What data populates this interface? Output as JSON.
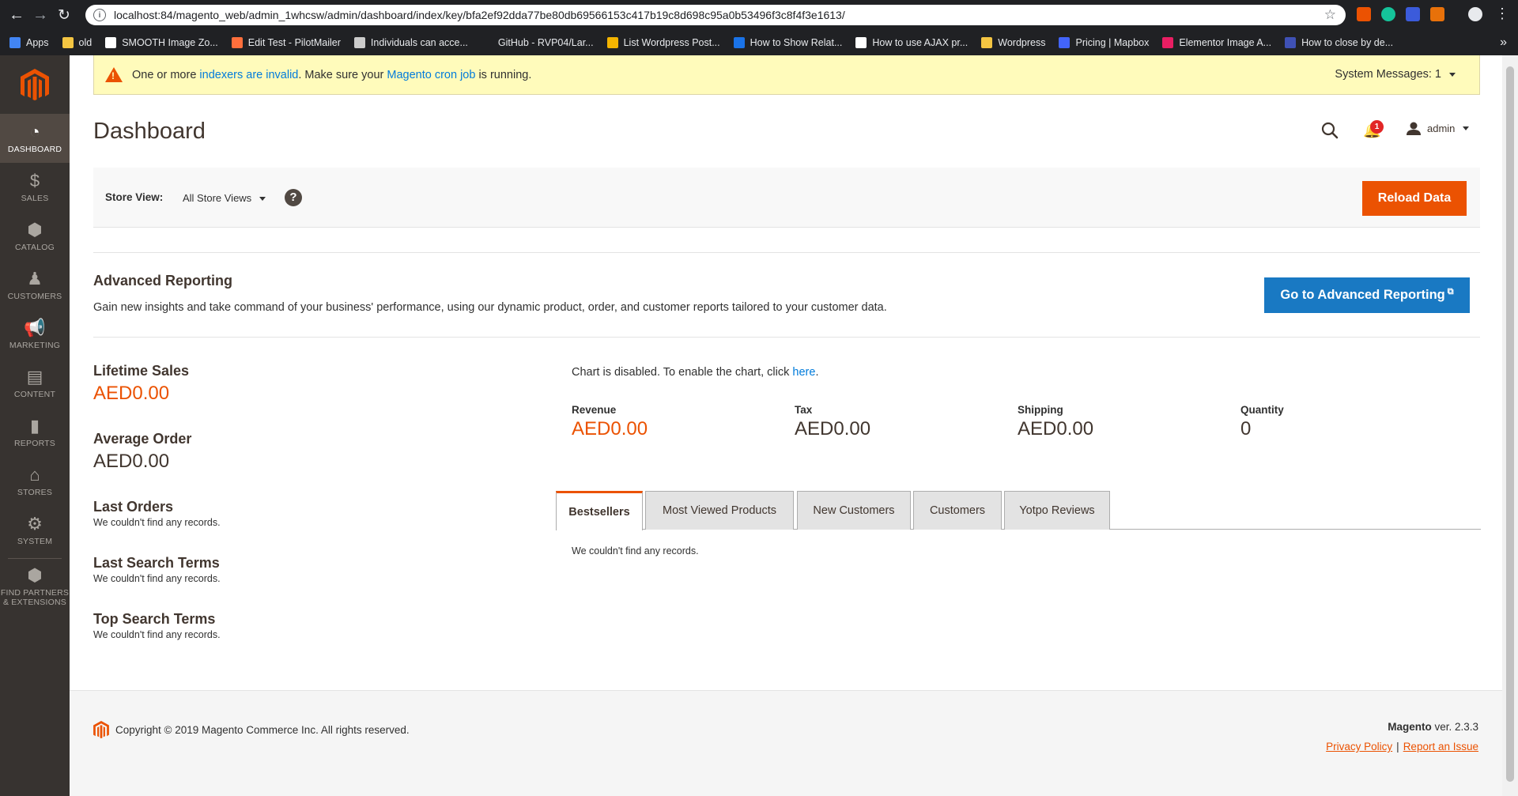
{
  "browser": {
    "url": "localhost:84/magento_web/admin_1whcsw/admin/dashboard/index/key/bfa2ef92dda77be80db69566153c417b19c8d698c95a0b53496f3c8f4f3e1613/",
    "bookmarks": [
      {
        "label": "Apps",
        "icon": "apps-grid-icon",
        "color": "#4285f4"
      },
      {
        "label": "old",
        "icon": "folder-icon",
        "color": "#f4c542"
      },
      {
        "label": "SMOOTH Image Zo...",
        "icon": "smooth-icon",
        "color": "#ffffff"
      },
      {
        "label": "Edit Test - PilotMailer",
        "icon": "pilotmailer-icon",
        "color": "#ff6f3c"
      },
      {
        "label": "Individuals can acce...",
        "icon": "tools-icon",
        "color": "#cccccc"
      },
      {
        "label": "GitHub - RVP04/Lar...",
        "icon": "github-icon",
        "color": "#202124"
      },
      {
        "label": "List Wordpress Post...",
        "icon": "crown-icon",
        "color": "#f4b400"
      },
      {
        "label": "How to Show Relat...",
        "icon": "site-icon",
        "color": "#1a73e8"
      },
      {
        "label": "How to use AJAX pr...",
        "icon": "medium-icon",
        "color": "#ffffff"
      },
      {
        "label": "Wordpress",
        "icon": "folder-icon",
        "color": "#f4c542"
      },
      {
        "label": "Pricing | Mapbox",
        "icon": "mapbox-icon",
        "color": "#4264fb"
      },
      {
        "label": "Elementor Image A...",
        "icon": "elementor-icon",
        "color": "#e91e63"
      },
      {
        "label": "How to close by de...",
        "icon": "star-bookmark-icon",
        "color": "#3f51b5"
      }
    ]
  },
  "sidebar": {
    "items": [
      {
        "label": "DASHBOARD",
        "icon": "dashboard-icon",
        "glyph": "◔"
      },
      {
        "label": "SALES",
        "icon": "dollar-icon",
        "glyph": "$"
      },
      {
        "label": "CATALOG",
        "icon": "box-icon",
        "glyph": "⬢"
      },
      {
        "label": "CUSTOMERS",
        "icon": "person-icon",
        "glyph": "♟"
      },
      {
        "label": "MARKETING",
        "icon": "megaphone-icon",
        "glyph": "📢"
      },
      {
        "label": "CONTENT",
        "icon": "layout-icon",
        "glyph": "▤"
      },
      {
        "label": "REPORTS",
        "icon": "bar-chart-icon",
        "glyph": "▮"
      },
      {
        "label": "STORES",
        "icon": "storefront-icon",
        "glyph": "⌂"
      },
      {
        "label": "SYSTEM",
        "icon": "gear-icon",
        "glyph": "⚙"
      },
      {
        "label": "FIND PARTNERS & EXTENSIONS",
        "icon": "boxes-icon",
        "glyph": "⬢"
      }
    ]
  },
  "system_message": {
    "prefix": "One or more ",
    "link1": "indexers are invalid",
    "middle": ". Make sure your ",
    "link2": "Magento cron job",
    "suffix": " is running.",
    "counter": "System Messages: 1"
  },
  "header": {
    "title": "Dashboard",
    "notifications_count": "1",
    "user": "admin"
  },
  "store_switcher": {
    "label": "Store View:",
    "value": "All Store Views",
    "reload_button": "Reload Data"
  },
  "advanced_reporting": {
    "title": "Advanced Reporting",
    "description": "Gain new insights and take command of your business' performance, using our dynamic product, order, and customer reports tailored to your customer data.",
    "button": "Go to Advanced Reporting"
  },
  "stats": {
    "lifetime_sales_label": "Lifetime Sales",
    "lifetime_sales_value": "AED0.00",
    "average_order_label": "Average Order",
    "average_order_value": "AED0.00",
    "last_orders_label": "Last Orders",
    "last_orders_empty": "We couldn't find any records.",
    "last_search_label": "Last Search Terms",
    "last_search_empty": "We couldn't find any records.",
    "top_search_label": "Top Search Terms",
    "top_search_empty": "We couldn't find any records."
  },
  "chart": {
    "disabled_text": "Chart is disabled. To enable the chart, click ",
    "link": "here",
    "suffix": "."
  },
  "totals": [
    {
      "label": "Revenue",
      "value": "AED0.00"
    },
    {
      "label": "Tax",
      "value": "AED0.00"
    },
    {
      "label": "Shipping",
      "value": "AED0.00"
    },
    {
      "label": "Quantity",
      "value": "0"
    }
  ],
  "tabs": [
    {
      "label": "Bestsellers",
      "active": true
    },
    {
      "label": "Most Viewed Products",
      "active": false
    },
    {
      "label": "New Customers",
      "active": false
    },
    {
      "label": "Customers",
      "active": false
    },
    {
      "label": "Yotpo Reviews",
      "active": false
    }
  ],
  "tab_content_empty": "We couldn't find any records.",
  "footer": {
    "copyright": "Copyright © 2019 Magento Commerce Inc. All rights reserved.",
    "brand": "Magento",
    "version": " ver. 2.3.3",
    "privacy": "Privacy Policy",
    "separator": "|",
    "report": "Report an Issue"
  },
  "colors": {
    "accent_orange": "#eb5202",
    "link_blue": "#007bdb",
    "button_blue": "#1979c3",
    "sidebar_bg": "#373330",
    "message_bg": "#fffbbb"
  }
}
